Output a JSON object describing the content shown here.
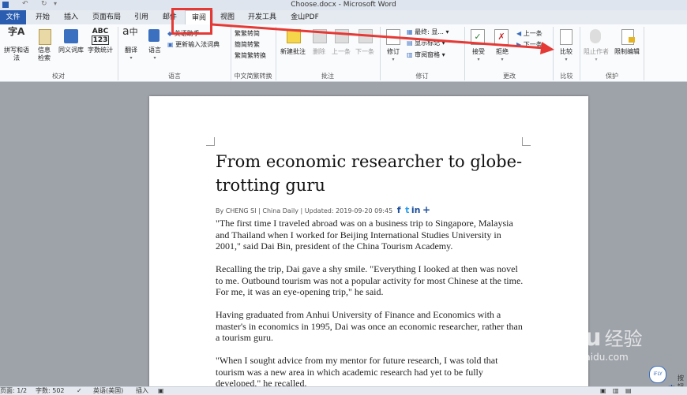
{
  "window": {
    "title": "Choose.docx - Microsoft Word"
  },
  "tabs": [
    {
      "id": "file",
      "label": "文件"
    },
    {
      "id": "home",
      "label": "开始"
    },
    {
      "id": "insert",
      "label": "插入"
    },
    {
      "id": "layout",
      "label": "页面布局"
    },
    {
      "id": "references",
      "label": "引用"
    },
    {
      "id": "mailings",
      "label": "邮件"
    },
    {
      "id": "review",
      "label": "审阅"
    },
    {
      "id": "view",
      "label": "视图"
    },
    {
      "id": "developer",
      "label": "开发工具"
    },
    {
      "id": "wps",
      "label": "金山PDF"
    }
  ],
  "ribbon": {
    "proofing": {
      "label": "校对",
      "spelling": "拼写和语法",
      "research": "信息检索",
      "thesaurus": "同义词库",
      "wordcount": "字数统计",
      "abc": "ABC",
      "abc_num": "123"
    },
    "language": {
      "label": "语言",
      "translate": "翻译",
      "language": "语言",
      "ime1": "英语助手",
      "ime2": "更新输入法词典"
    },
    "chinese": {
      "label": "中文简繁转换",
      "t2s": "繁转简",
      "s2t": "简转繁",
      "convert": "简繁转换"
    },
    "comments": {
      "label": "批注",
      "new": "新建批注",
      "delete": "删除",
      "prev": "上一条",
      "next": "下一条"
    },
    "tracking": {
      "label": "修订",
      "track": "修订",
      "display": "最终: 显...",
      "markup": "显示标记",
      "pane": "审阅窗格"
    },
    "changes": {
      "label": "更改",
      "accept": "接受",
      "reject": "拒绝",
      "prev": "上一条",
      "next": "下一条"
    },
    "compare": {
      "label": "比较",
      "compare": "比较"
    },
    "protect": {
      "label": "保护",
      "block": "阻止作者",
      "restrict": "限制编辑"
    }
  },
  "document": {
    "title": "From economic researcher to globe-trotting guru",
    "byline": "By CHENG SI | China Daily | Updated: 2019-09-20 09:45",
    "social": [
      "f",
      "t",
      "in",
      "+"
    ],
    "paragraphs": [
      "\"The first time I traveled abroad was on a business trip to Singapore, Malaysia and Thailand when I worked for Beijing International Studies University in 2001,\" said Dai Bin, president of the China Tourism Academy.",
      "Recalling the trip, Dai gave a shy smile. \"Everything I looked at then was novel to me. Outbound tourism was not a popular activity for most Chinese at the time. For me, it was an eye-opening trip,\" he said.",
      "Having graduated from Anhui University of Finance and Economics with a master's in economics in 1995, Dai was once an economic researcher, rather than a tourism guru.",
      "\"When I sought advice from my mentor for future research, I was told that tourism was a new area in which academic research had yet to be fully developed,\" he recalled."
    ]
  },
  "status": {
    "page": "页面: 1/2",
    "words": "字数: 502",
    "language": "英语(美国)",
    "mode": "插入"
  },
  "watermark": {
    "brand": "Bai",
    "brand2": "经验",
    "site": "jingyan.baidu.com"
  },
  "side_widget": {
    "text1": "按钮",
    "text2": "中 ."
  },
  "colors": {
    "file_tab": "#2a5db0",
    "annotation": "#e53935",
    "ribbon_bg": "#fafbfd"
  }
}
